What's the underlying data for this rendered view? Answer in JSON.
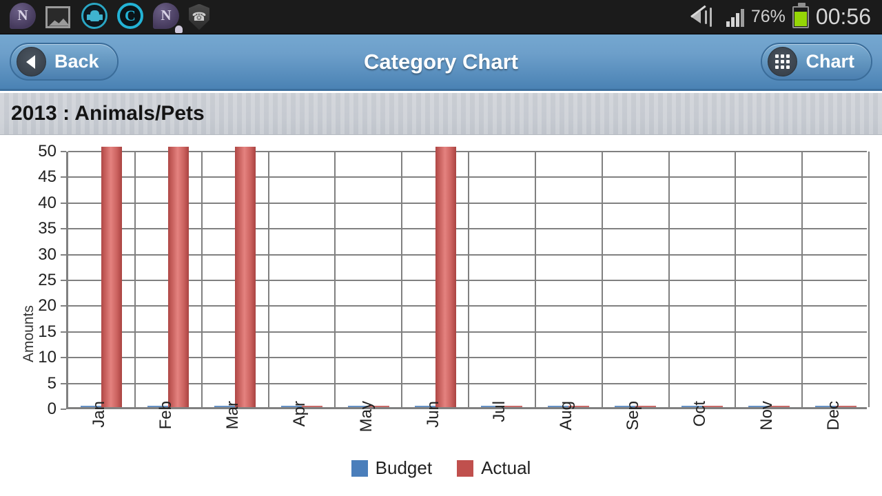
{
  "statusbar": {
    "notifications": [
      {
        "name": "note-app-icon",
        "glyph": "N"
      },
      {
        "name": "gallery-icon",
        "glyph": ""
      },
      {
        "name": "android-sync-icon",
        "glyph": ""
      },
      {
        "name": "clean-master-icon",
        "glyph": "C"
      },
      {
        "name": "note-notification-icon",
        "glyph": "N"
      },
      {
        "name": "call-shield-icon",
        "glyph": "✆"
      }
    ],
    "mute_icon": "sound-mute-vibrate-icon",
    "signal_icon": "signal-bars-icon",
    "battery_percent": "76%",
    "battery_level": 76,
    "clock": "00:56"
  },
  "titlebar": {
    "back_label": "Back",
    "title": "Category Chart",
    "chart_label": "Chart"
  },
  "subtitle": "2013 : Animals/Pets",
  "chart_data": {
    "type": "bar",
    "title": "2013 : Animals/Pets",
    "xlabel": "",
    "ylabel": "Amounts",
    "categories": [
      "Jan",
      "Feb",
      "Mar",
      "Apr",
      "May",
      "Jun",
      "Jul",
      "Aug",
      "Sep",
      "Oct",
      "Nov",
      "Dec"
    ],
    "yticks": [
      0,
      5,
      10,
      15,
      20,
      25,
      30,
      35,
      40,
      45,
      50
    ],
    "ylim": [
      0,
      50
    ],
    "grid": true,
    "legend_position": "bottom",
    "series": [
      {
        "name": "Budget",
        "color": "#4a7ebb",
        "values": [
          0,
          0,
          0,
          0,
          0,
          0,
          0,
          0,
          0,
          0,
          0,
          0
        ]
      },
      {
        "name": "Actual",
        "color": "#c0504d",
        "values": [
          50,
          50,
          50,
          0,
          0,
          50,
          0,
          0,
          0,
          0,
          0,
          0
        ]
      }
    ]
  }
}
